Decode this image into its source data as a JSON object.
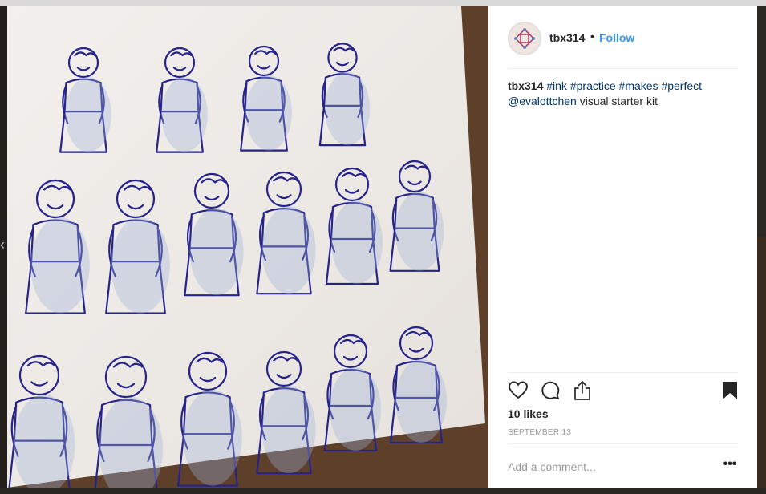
{
  "post": {
    "username": "tbx314",
    "separator": "•",
    "follow_label": "Follow",
    "caption": {
      "username": "tbx314",
      "tags": [
        "#ink",
        "#practice",
        "#makes",
        "#perfect"
      ],
      "mention": "@evalottchen",
      "text": "visual starter kit"
    },
    "likes": "10 likes",
    "date": "SEPTEMBER 13",
    "comment_placeholder": "Add a comment...",
    "more_label": "•••"
  },
  "icons": {
    "like": "heart-icon",
    "comment": "comment-bubble-icon",
    "share": "share-icon",
    "save": "bookmark-icon",
    "avatar": "avatar-pattern",
    "prev": "chevron-left-icon"
  },
  "colors": {
    "follow": "#3897f0",
    "hashtag": "#003569",
    "ink": "#25238a",
    "paper": "#f0ece8"
  }
}
